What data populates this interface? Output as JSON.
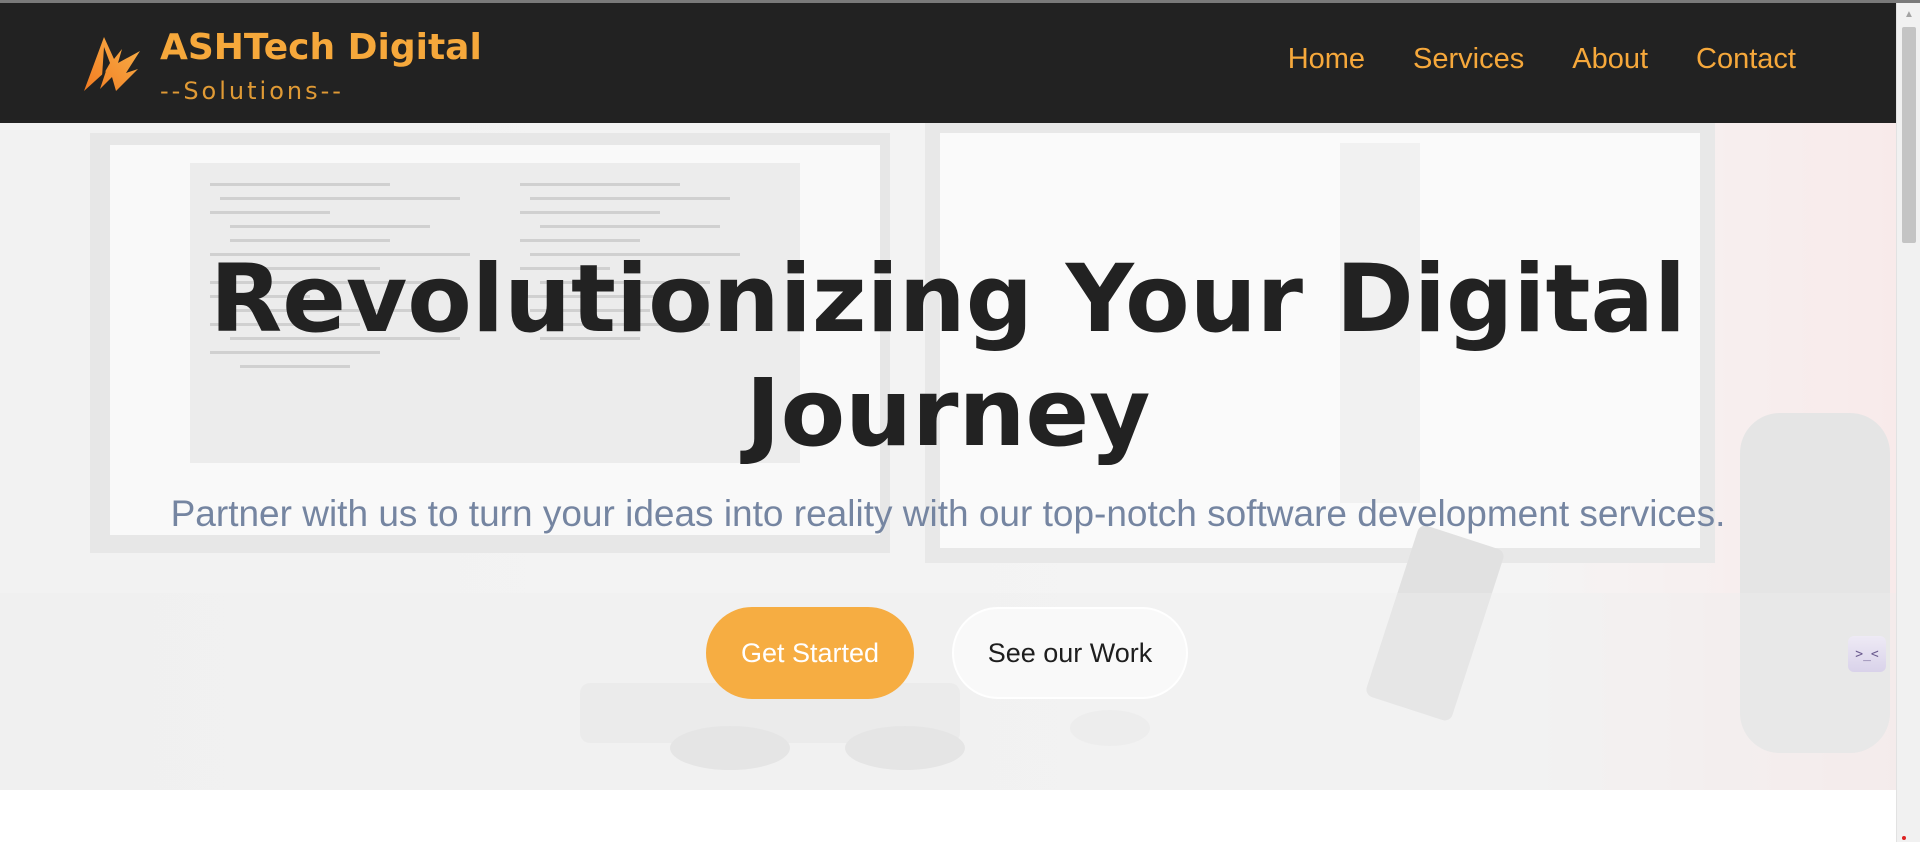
{
  "header": {
    "brand_name": "ASHTech Digital",
    "brand_tagline": "--Solutions--",
    "nav": [
      {
        "label": "Home"
      },
      {
        "label": "Services"
      },
      {
        "label": "About"
      },
      {
        "label": "Contact"
      }
    ]
  },
  "hero": {
    "title_line1": "Revolutionizing Your Digital",
    "title_line2": "Journey",
    "subtitle": "Partner with us to turn your ideas into reality with our top-notch software development services.",
    "primary_button": "Get Started",
    "secondary_button": "See our Work"
  },
  "widget": {
    "glyph": ">_<",
    "icon": "chat-widget-icon"
  },
  "colors": {
    "accent": "#f6a83b",
    "header_bg": "#222222",
    "title": "#222222",
    "subtitle": "#7585a1",
    "button_primary": "#f6ad42"
  }
}
